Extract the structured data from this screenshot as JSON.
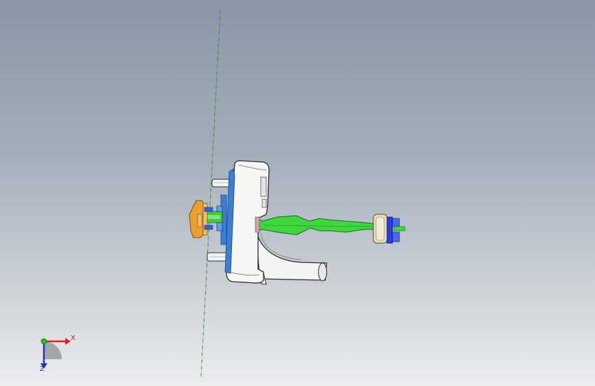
{
  "view": {
    "type": "cad-3d-viewport",
    "background_top": "#8a96a6",
    "background_bottom": "#eceef0",
    "sketch_line_color": "#2e8b2e"
  },
  "model": {
    "body_color": "#f4f4f2",
    "edge_color": "#2a2a2a",
    "blue_part_color": "#3a7fd0",
    "green_part_color": "#3fd63f",
    "orange_part_color": "#e8a030",
    "knob_color": "#e8dcc0",
    "connector_blue": "#2a3fd8"
  },
  "triad": {
    "x_label": "X",
    "z_label": "Z",
    "x_color": "#e02020",
    "y_color": "#20c020",
    "z_color": "#2030d0"
  }
}
